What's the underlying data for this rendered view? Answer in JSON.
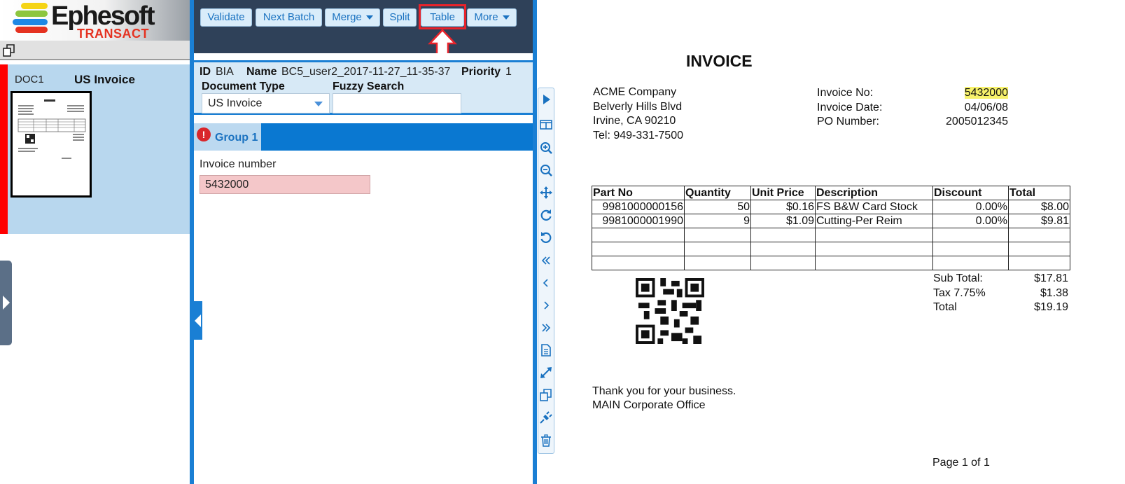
{
  "logo": {
    "name": "Ephesoft",
    "sub": "TRANSACT",
    "stripe_colors": [
      "#f5d415",
      "#8dc63f",
      "#1e88e5",
      "#e53221"
    ]
  },
  "document_list": {
    "items": [
      {
        "id": "DOC1",
        "type": "US Invoice"
      }
    ]
  },
  "toolbar": {
    "buttons": [
      {
        "label": "Validate"
      },
      {
        "label": "Next Batch"
      },
      {
        "label": "Merge"
      },
      {
        "label": "Split"
      },
      {
        "label": "Table"
      },
      {
        "label": "More"
      }
    ],
    "highlighted": "Table"
  },
  "batch": {
    "id_label": "ID",
    "id_value": "BIA",
    "name_label": "Name",
    "name_value": "BC5_user2_2017-11-27_11-35-37",
    "priority_label": "Priority",
    "priority_value": "1"
  },
  "doc_type": {
    "label": "Document Type",
    "value": "US Invoice"
  },
  "fuzzy_search": {
    "label": "Fuzzy Search",
    "value": ""
  },
  "group": {
    "label": "Group 1",
    "error_icon": "!"
  },
  "fields": [
    {
      "label": "Invoice number",
      "value": "5432000",
      "status": "error"
    }
  ],
  "viewer_tools": [
    "play-icon",
    "two-column-icon",
    "zoom-in-icon",
    "zoom-out-icon",
    "move-icon",
    "rotate-cw-icon",
    "rotate-ccw-icon",
    "first-page-icon",
    "prev-page-icon",
    "next-page-icon",
    "last-page-icon",
    "document-icon",
    "fit-icon",
    "copy-icon",
    "plugin-icon",
    "delete-icon"
  ],
  "invoice": {
    "title": "INVOICE",
    "company": [
      "ACME Company",
      "Belverly Hills Blvd",
      "Irvine, CA 90210",
      "Tel: 949-331-7500"
    ],
    "meta": [
      {
        "label": "Invoice No:",
        "value": "5432000"
      },
      {
        "label": "Invoice Date:",
        "value": "04/06/08"
      },
      {
        "label": "PO Number:",
        "value": "2005012345"
      }
    ],
    "columns": [
      "Part No",
      "Quantity",
      "Unit Price",
      "Description",
      "Discount",
      "Total"
    ],
    "rows": [
      [
        "9981000000156",
        "50",
        "$0.16",
        "FS B&W Card Stock",
        "0.00%",
        "$8.00"
      ],
      [
        "9981000001990",
        "9",
        "$1.09",
        "Cutting-Per Reim",
        "0.00%",
        "$9.81"
      ]
    ],
    "totals": [
      {
        "label": "Sub Total:",
        "value": "$17.81"
      },
      {
        "label": "Tax 7.75%",
        "value": "$1.38"
      },
      {
        "label": "Total",
        "value": "$19.19"
      }
    ],
    "footer": [
      "Thank you for your business.",
      "MAIN Corporate Office"
    ],
    "page": "Page 1 of 1"
  }
}
